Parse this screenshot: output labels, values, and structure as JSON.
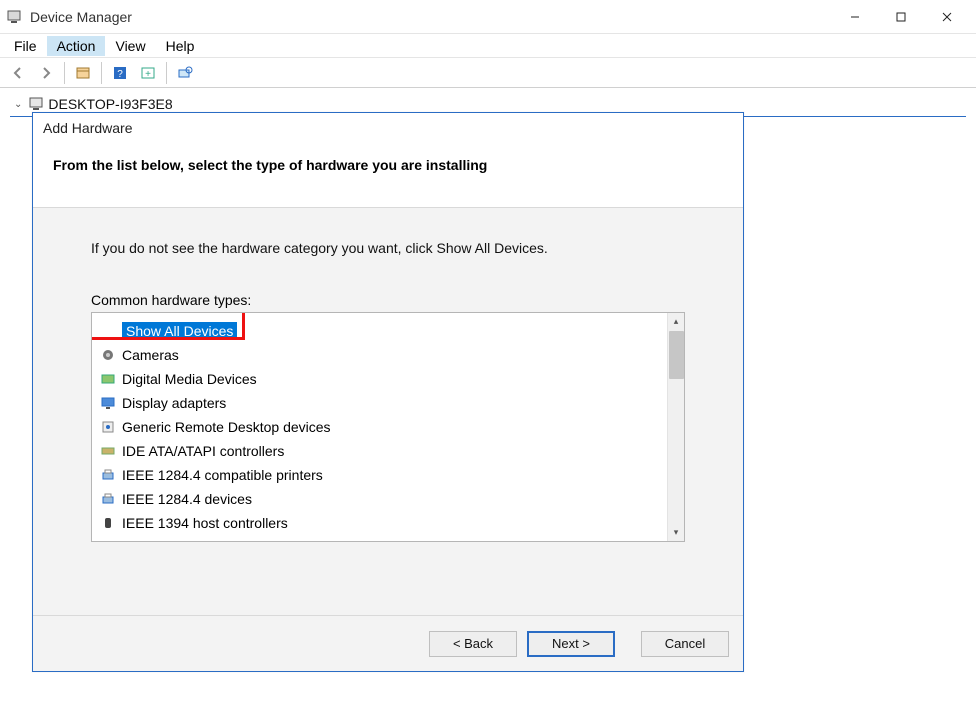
{
  "window": {
    "title": "Device Manager"
  },
  "menubar": {
    "file": "File",
    "action": "Action",
    "view": "View",
    "help": "Help"
  },
  "toolbar": {
    "back": "back-arrow",
    "forward": "forward-arrow",
    "prop": "properties",
    "help": "help",
    "refresh": "add-view",
    "scan": "scan-hw"
  },
  "tree": {
    "root": "DESKTOP-I93F3E8"
  },
  "dialog": {
    "title": "Add Hardware",
    "heading": "From the list below, select the type of hardware you are installing",
    "hint": "If you do not see the hardware category you want, click Show All Devices.",
    "list_label": "Common hardware types:",
    "items": [
      {
        "label": "Show All Devices",
        "icon": "blank",
        "selected": true
      },
      {
        "label": "Cameras",
        "icon": "camera"
      },
      {
        "label": "Digital Media Devices",
        "icon": "media"
      },
      {
        "label": "Display adapters",
        "icon": "display"
      },
      {
        "label": "Generic Remote Desktop devices",
        "icon": "remote"
      },
      {
        "label": "IDE ATA/ATAPI controllers",
        "icon": "ide"
      },
      {
        "label": "IEEE 1284.4 compatible printers",
        "icon": "printer"
      },
      {
        "label": "IEEE 1284.4 devices",
        "icon": "printer"
      },
      {
        "label": "IEEE 1394 host controllers",
        "icon": "firewire"
      }
    ],
    "buttons": {
      "back": "< Back",
      "next": "Next >",
      "cancel": "Cancel"
    }
  }
}
